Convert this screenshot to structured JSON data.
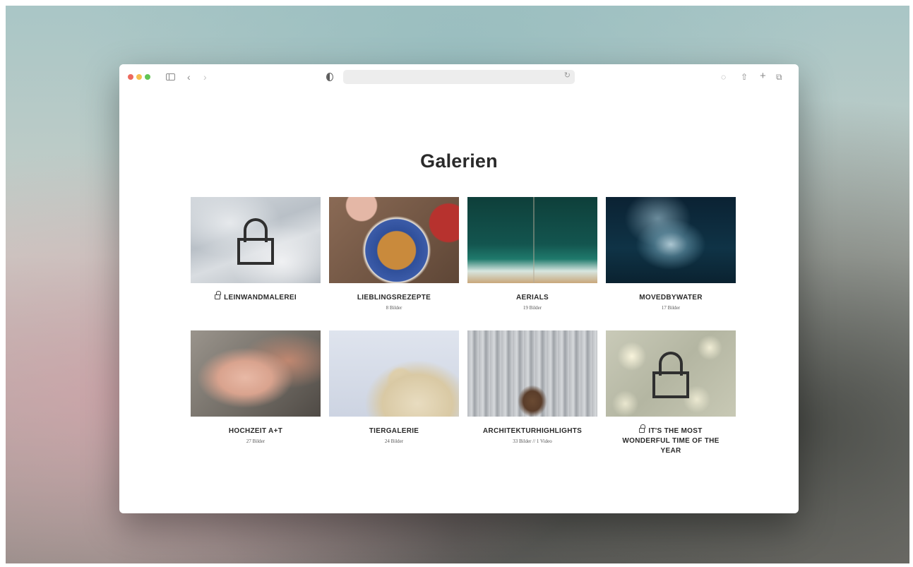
{
  "page": {
    "title": "Galerien"
  },
  "galleries": [
    {
      "title": "LEINWANDMALEREI",
      "subtitle": "",
      "locked": true,
      "icon": "lock-icon"
    },
    {
      "title": "LIEBLINGSREZEPTE",
      "subtitle": "8 Bilder",
      "locked": false
    },
    {
      "title": "AERIALS",
      "subtitle": "19 Bilder",
      "locked": false
    },
    {
      "title": "MOVEDBYWATER",
      "subtitle": "17 Bilder",
      "locked": false
    },
    {
      "title": "HOCHZEIT A+T",
      "subtitle": "27 Bilder",
      "locked": false
    },
    {
      "title": "TIERGALERIE",
      "subtitle": "24 Bilder",
      "locked": false
    },
    {
      "title": "ARCHITEKTURHIGHLIGHTS",
      "subtitle": "33 Bilder // 1 Video",
      "locked": false
    },
    {
      "title": "IT'S THE MOST WONDERFUL TIME OF THE YEAR",
      "subtitle": "",
      "locked": true,
      "icon": "lock-icon"
    }
  ],
  "colors": {
    "traffic_red": "#ed6a5e",
    "traffic_yellow": "#f5bf4f",
    "traffic_green": "#61c554",
    "text_dark": "#2a2a2a"
  }
}
